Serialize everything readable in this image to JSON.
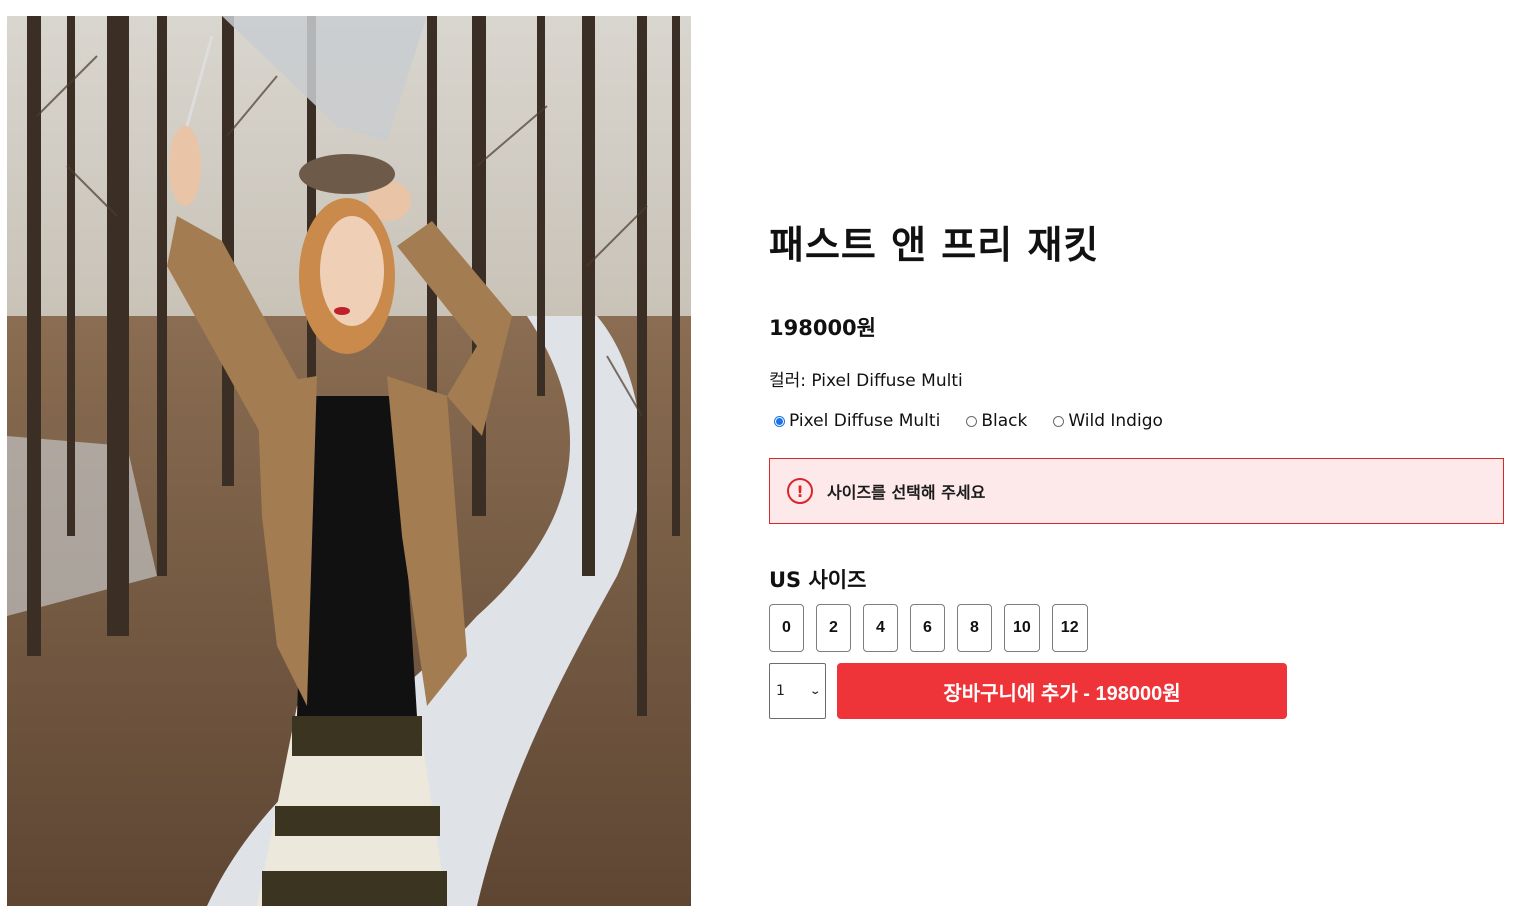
{
  "product": {
    "title": "패스트 앤 프리 재킷",
    "price": "198000원",
    "color_label": "컬러: Pixel Diffuse Multi",
    "colors": [
      {
        "label": "Pixel Diffuse Multi",
        "selected": true
      },
      {
        "label": "Black",
        "selected": false
      },
      {
        "label": "Wild Indigo",
        "selected": false
      }
    ]
  },
  "alert": {
    "icon": "exclamation-icon",
    "message": "사이즈를 선택해 주세요",
    "color": "#d9262c",
    "background": "#fde9ea"
  },
  "sizes": {
    "label": "US 사이즈",
    "options": [
      "0",
      "2",
      "4",
      "6",
      "8",
      "10",
      "12"
    ]
  },
  "cart": {
    "quantity": "1",
    "add_label": "장바구니에 추가 - 198000원",
    "button_color": "#ef3439"
  }
}
